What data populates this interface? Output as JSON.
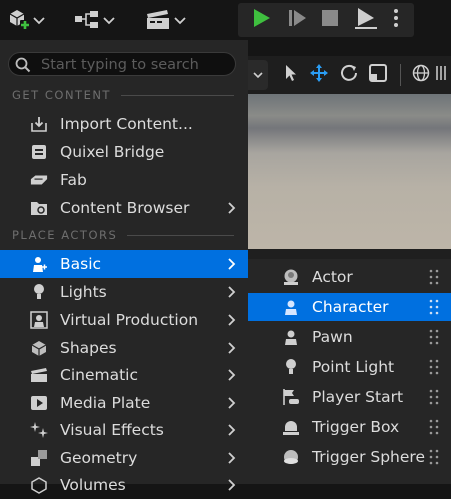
{
  "toolbar": {
    "icons": [
      "add-actor-icon",
      "blueprint-icon",
      "cinematics-icon",
      "play-icon",
      "skip-forward-icon",
      "stop-icon",
      "eject-icon",
      "more-options-icon"
    ]
  },
  "search": {
    "placeholder": "Start typing to search"
  },
  "sections": {
    "get_content": "GET CONTENT",
    "place_actors": "PLACE ACTORS"
  },
  "menu": {
    "get_content_items": [
      {
        "label": "Import Content...",
        "icon": "import-icon",
        "submenu": false
      },
      {
        "label": "Quixel Bridge",
        "icon": "bridge-icon",
        "submenu": false
      },
      {
        "label": "Fab",
        "icon": "fab-icon",
        "submenu": false
      },
      {
        "label": "Content Browser",
        "icon": "folder-icon",
        "submenu": true
      }
    ],
    "place_actors_items": [
      {
        "label": "Basic",
        "icon": "basic-icon",
        "submenu": true,
        "selected": true
      },
      {
        "label": "Lights",
        "icon": "light-bulb-icon",
        "submenu": true
      },
      {
        "label": "Virtual Production",
        "icon": "virtual-production-icon",
        "submenu": true
      },
      {
        "label": "Shapes",
        "icon": "shapes-icon",
        "submenu": true
      },
      {
        "label": "Cinematic",
        "icon": "clapper-icon",
        "submenu": true
      },
      {
        "label": "Media Plate",
        "icon": "media-plate-icon",
        "submenu": true
      },
      {
        "label": "Visual Effects",
        "icon": "sparkle-icon",
        "submenu": true
      },
      {
        "label": "Geometry",
        "icon": "geometry-icon",
        "submenu": true
      },
      {
        "label": "Volumes",
        "icon": "volume-icon",
        "submenu": true
      }
    ]
  },
  "submenu": {
    "items": [
      {
        "label": "Actor",
        "icon": "actor-icon"
      },
      {
        "label": "Character",
        "icon": "character-icon",
        "selected": true
      },
      {
        "label": "Pawn",
        "icon": "pawn-icon"
      },
      {
        "label": "Point Light",
        "icon": "point-light-icon"
      },
      {
        "label": "Player Start",
        "icon": "player-start-icon"
      },
      {
        "label": "Trigger Box",
        "icon": "trigger-box-icon"
      },
      {
        "label": "Trigger Sphere",
        "icon": "trigger-sphere-icon"
      }
    ]
  },
  "colors": {
    "accent": "#0070e0",
    "play_green": "#3fbf3f",
    "menu_bg": "#262626",
    "transform_blue": "#2a9df4"
  }
}
